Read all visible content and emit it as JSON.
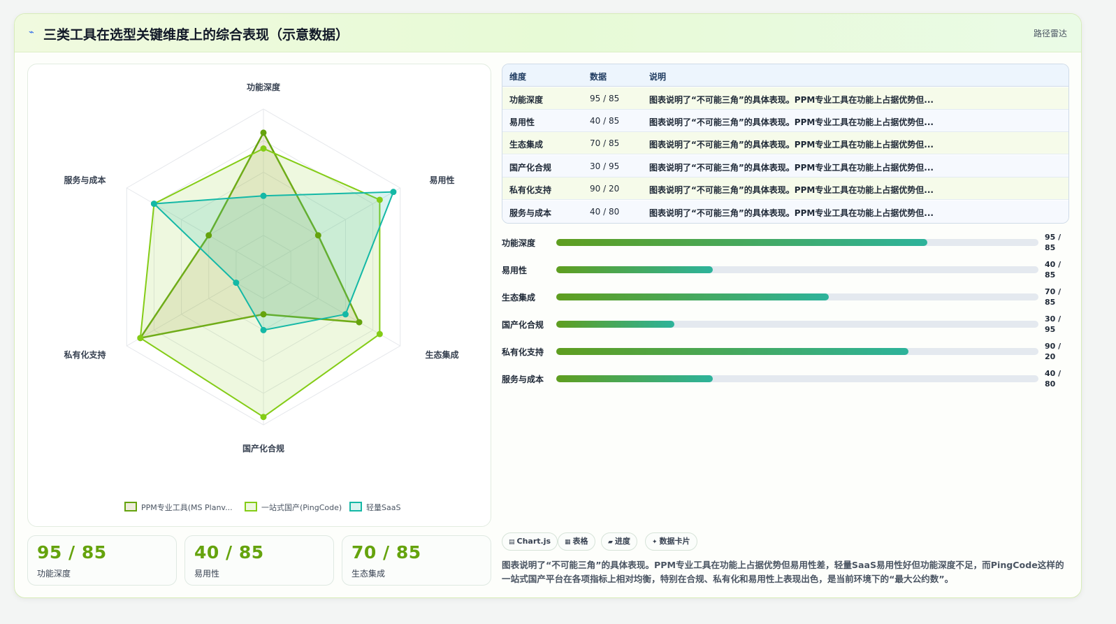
{
  "header": {
    "icon": "spark-icon",
    "title": "三类工具在选型关键维度上的综合表现（示意数据）",
    "tag": "路径雷达"
  },
  "chart_data": {
    "type": "radar",
    "axes": [
      "功能深度",
      "易用性",
      "生态集成",
      "国产化合规",
      "私有化支持",
      "服务与成本"
    ],
    "rmax": 100,
    "grid_rings": 5,
    "legend_position": "bottom",
    "series": [
      {
        "name": "PPM专业工具(MS Planv...",
        "values": [
          85,
          40,
          70,
          30,
          90,
          40
        ],
        "color": "#65a30d",
        "fill": "rgba(160,150,60,0.18)"
      },
      {
        "name": "一站式国产(PingCode)",
        "values": [
          75,
          85,
          85,
          95,
          90,
          80
        ],
        "color": "#84cc16",
        "fill": "rgba(163,214,80,0.18)"
      },
      {
        "name": "轻量SaaS",
        "values": [
          45,
          95,
          60,
          40,
          20,
          80
        ],
        "color": "#14b8a6",
        "fill": "rgba(45,190,170,0.18)"
      }
    ]
  },
  "table": {
    "headers": [
      "维度",
      "数据",
      "说明"
    ],
    "rows": [
      {
        "name": "功能深度",
        "value": "95 / 85",
        "desc": "图表说明了“不可能三角”的具体表现。PPM专业工具在功能上占据优势但..."
      },
      {
        "name": "易用性",
        "value": "40 / 85",
        "desc": "图表说明了“不可能三角”的具体表现。PPM专业工具在功能上占据优势但..."
      },
      {
        "name": "生态集成",
        "value": "70 / 85",
        "desc": "图表说明了“不可能三角”的具体表现。PPM专业工具在功能上占据优势但..."
      },
      {
        "name": "国产化合规",
        "value": "30 / 95",
        "desc": "图表说明了“不可能三角”的具体表现。PPM专业工具在功能上占据优势但..."
      },
      {
        "name": "私有化支持",
        "value": "90 / 20",
        "desc": "图表说明了“不可能三角”的具体表现。PPM专业工具在功能上占据优势但..."
      },
      {
        "name": "服务与成本",
        "value": "40 / 80",
        "desc": "图表说明了“不可能三角”的具体表现。PPM专业工具在功能上占据优势但..."
      }
    ]
  },
  "bars": [
    {
      "label": "功能深度",
      "value": "95 / 85",
      "progress": 0.77
    },
    {
      "label": "易用性",
      "value": "40 / 85",
      "progress": 0.325
    },
    {
      "label": "生态集成",
      "value": "70 / 85",
      "progress": 0.565
    },
    {
      "label": "国产化合规",
      "value": "30 / 95",
      "progress": 0.245
    },
    {
      "label": "私有化支持",
      "value": "90 / 20",
      "progress": 0.73
    },
    {
      "label": "服务与成本",
      "value": "40 / 80",
      "progress": 0.325
    }
  ],
  "stats": [
    {
      "value": "95 / 85",
      "label": "功能深度"
    },
    {
      "value": "40 / 85",
      "label": "易用性"
    },
    {
      "value": "70 / 85",
      "label": "生态集成"
    }
  ],
  "chips": [
    {
      "icon": "chart-icon",
      "glyph": "▤",
      "label": "Chart.js"
    },
    {
      "icon": "table-icon",
      "glyph": "▦",
      "label": "表格"
    },
    {
      "icon": "progress-icon",
      "glyph": "▰",
      "label": "进度"
    },
    {
      "icon": "card-icon",
      "glyph": "✦",
      "label": "数据卡片"
    }
  ],
  "note": "图表说明了“不可能三角”的具体表现。PPM专业工具在功能上占据优势但易用性差，轻量SaaS易用性好但功能深度不足，而PingCode这样的一站式国产平台在各项指标上相对均衡，特别在合规、私有化和易用性上表现出色，是当前环境下的“最大公约数”。"
}
